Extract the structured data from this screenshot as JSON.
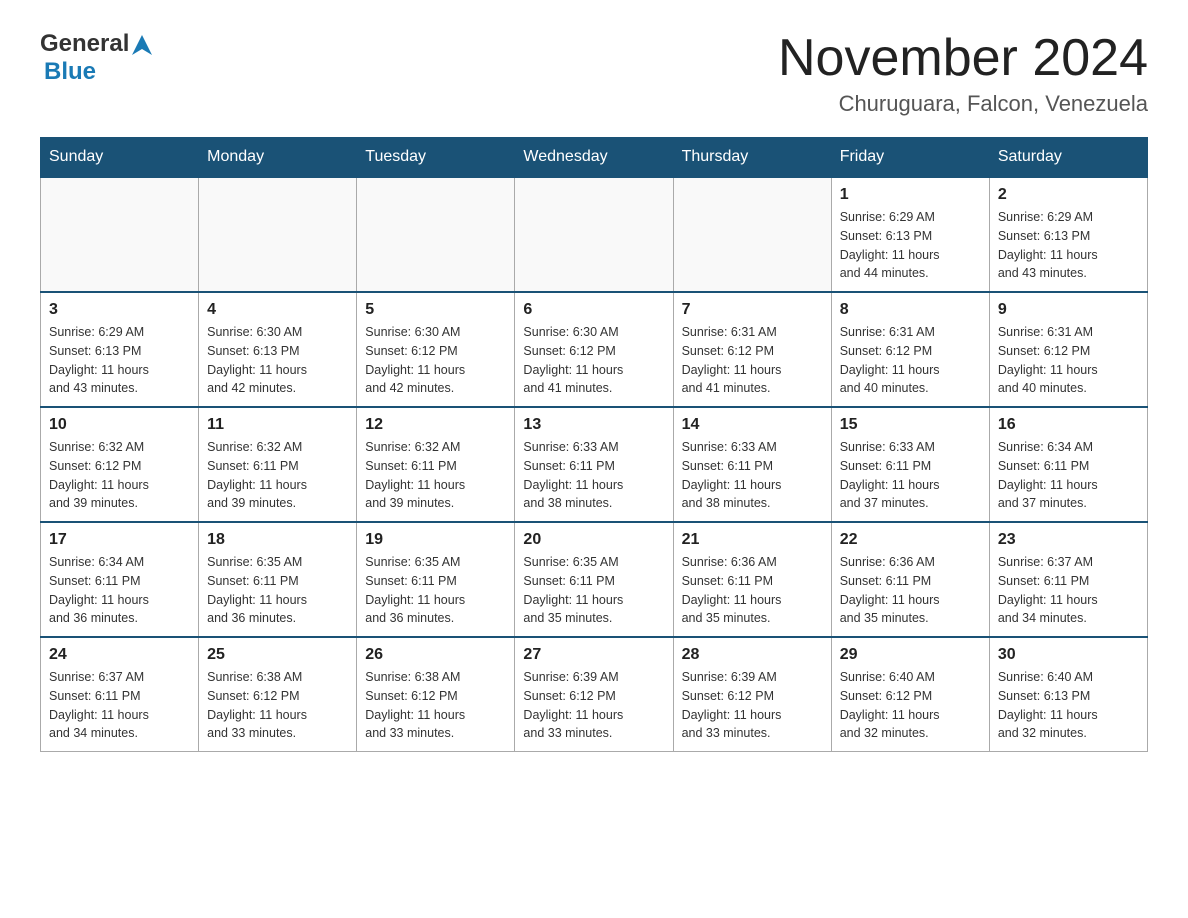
{
  "logo": {
    "text_general": "General",
    "text_blue": "Blue",
    "arrow": "▲"
  },
  "title": "November 2024",
  "subtitle": "Churuguara, Falcon, Venezuela",
  "days_of_week": [
    "Sunday",
    "Monday",
    "Tuesday",
    "Wednesday",
    "Thursday",
    "Friday",
    "Saturday"
  ],
  "weeks": [
    [
      {
        "day": "",
        "info": ""
      },
      {
        "day": "",
        "info": ""
      },
      {
        "day": "",
        "info": ""
      },
      {
        "day": "",
        "info": ""
      },
      {
        "day": "",
        "info": ""
      },
      {
        "day": "1",
        "info": "Sunrise: 6:29 AM\nSunset: 6:13 PM\nDaylight: 11 hours\nand 44 minutes."
      },
      {
        "day": "2",
        "info": "Sunrise: 6:29 AM\nSunset: 6:13 PM\nDaylight: 11 hours\nand 43 minutes."
      }
    ],
    [
      {
        "day": "3",
        "info": "Sunrise: 6:29 AM\nSunset: 6:13 PM\nDaylight: 11 hours\nand 43 minutes."
      },
      {
        "day": "4",
        "info": "Sunrise: 6:30 AM\nSunset: 6:13 PM\nDaylight: 11 hours\nand 42 minutes."
      },
      {
        "day": "5",
        "info": "Sunrise: 6:30 AM\nSunset: 6:12 PM\nDaylight: 11 hours\nand 42 minutes."
      },
      {
        "day": "6",
        "info": "Sunrise: 6:30 AM\nSunset: 6:12 PM\nDaylight: 11 hours\nand 41 minutes."
      },
      {
        "day": "7",
        "info": "Sunrise: 6:31 AM\nSunset: 6:12 PM\nDaylight: 11 hours\nand 41 minutes."
      },
      {
        "day": "8",
        "info": "Sunrise: 6:31 AM\nSunset: 6:12 PM\nDaylight: 11 hours\nand 40 minutes."
      },
      {
        "day": "9",
        "info": "Sunrise: 6:31 AM\nSunset: 6:12 PM\nDaylight: 11 hours\nand 40 minutes."
      }
    ],
    [
      {
        "day": "10",
        "info": "Sunrise: 6:32 AM\nSunset: 6:12 PM\nDaylight: 11 hours\nand 39 minutes."
      },
      {
        "day": "11",
        "info": "Sunrise: 6:32 AM\nSunset: 6:11 PM\nDaylight: 11 hours\nand 39 minutes."
      },
      {
        "day": "12",
        "info": "Sunrise: 6:32 AM\nSunset: 6:11 PM\nDaylight: 11 hours\nand 39 minutes."
      },
      {
        "day": "13",
        "info": "Sunrise: 6:33 AM\nSunset: 6:11 PM\nDaylight: 11 hours\nand 38 minutes."
      },
      {
        "day": "14",
        "info": "Sunrise: 6:33 AM\nSunset: 6:11 PM\nDaylight: 11 hours\nand 38 minutes."
      },
      {
        "day": "15",
        "info": "Sunrise: 6:33 AM\nSunset: 6:11 PM\nDaylight: 11 hours\nand 37 minutes."
      },
      {
        "day": "16",
        "info": "Sunrise: 6:34 AM\nSunset: 6:11 PM\nDaylight: 11 hours\nand 37 minutes."
      }
    ],
    [
      {
        "day": "17",
        "info": "Sunrise: 6:34 AM\nSunset: 6:11 PM\nDaylight: 11 hours\nand 36 minutes."
      },
      {
        "day": "18",
        "info": "Sunrise: 6:35 AM\nSunset: 6:11 PM\nDaylight: 11 hours\nand 36 minutes."
      },
      {
        "day": "19",
        "info": "Sunrise: 6:35 AM\nSunset: 6:11 PM\nDaylight: 11 hours\nand 36 minutes."
      },
      {
        "day": "20",
        "info": "Sunrise: 6:35 AM\nSunset: 6:11 PM\nDaylight: 11 hours\nand 35 minutes."
      },
      {
        "day": "21",
        "info": "Sunrise: 6:36 AM\nSunset: 6:11 PM\nDaylight: 11 hours\nand 35 minutes."
      },
      {
        "day": "22",
        "info": "Sunrise: 6:36 AM\nSunset: 6:11 PM\nDaylight: 11 hours\nand 35 minutes."
      },
      {
        "day": "23",
        "info": "Sunrise: 6:37 AM\nSunset: 6:11 PM\nDaylight: 11 hours\nand 34 minutes."
      }
    ],
    [
      {
        "day": "24",
        "info": "Sunrise: 6:37 AM\nSunset: 6:11 PM\nDaylight: 11 hours\nand 34 minutes."
      },
      {
        "day": "25",
        "info": "Sunrise: 6:38 AM\nSunset: 6:12 PM\nDaylight: 11 hours\nand 33 minutes."
      },
      {
        "day": "26",
        "info": "Sunrise: 6:38 AM\nSunset: 6:12 PM\nDaylight: 11 hours\nand 33 minutes."
      },
      {
        "day": "27",
        "info": "Sunrise: 6:39 AM\nSunset: 6:12 PM\nDaylight: 11 hours\nand 33 minutes."
      },
      {
        "day": "28",
        "info": "Sunrise: 6:39 AM\nSunset: 6:12 PM\nDaylight: 11 hours\nand 33 minutes."
      },
      {
        "day": "29",
        "info": "Sunrise: 6:40 AM\nSunset: 6:12 PM\nDaylight: 11 hours\nand 32 minutes."
      },
      {
        "day": "30",
        "info": "Sunrise: 6:40 AM\nSunset: 6:13 PM\nDaylight: 11 hours\nand 32 minutes."
      }
    ]
  ]
}
